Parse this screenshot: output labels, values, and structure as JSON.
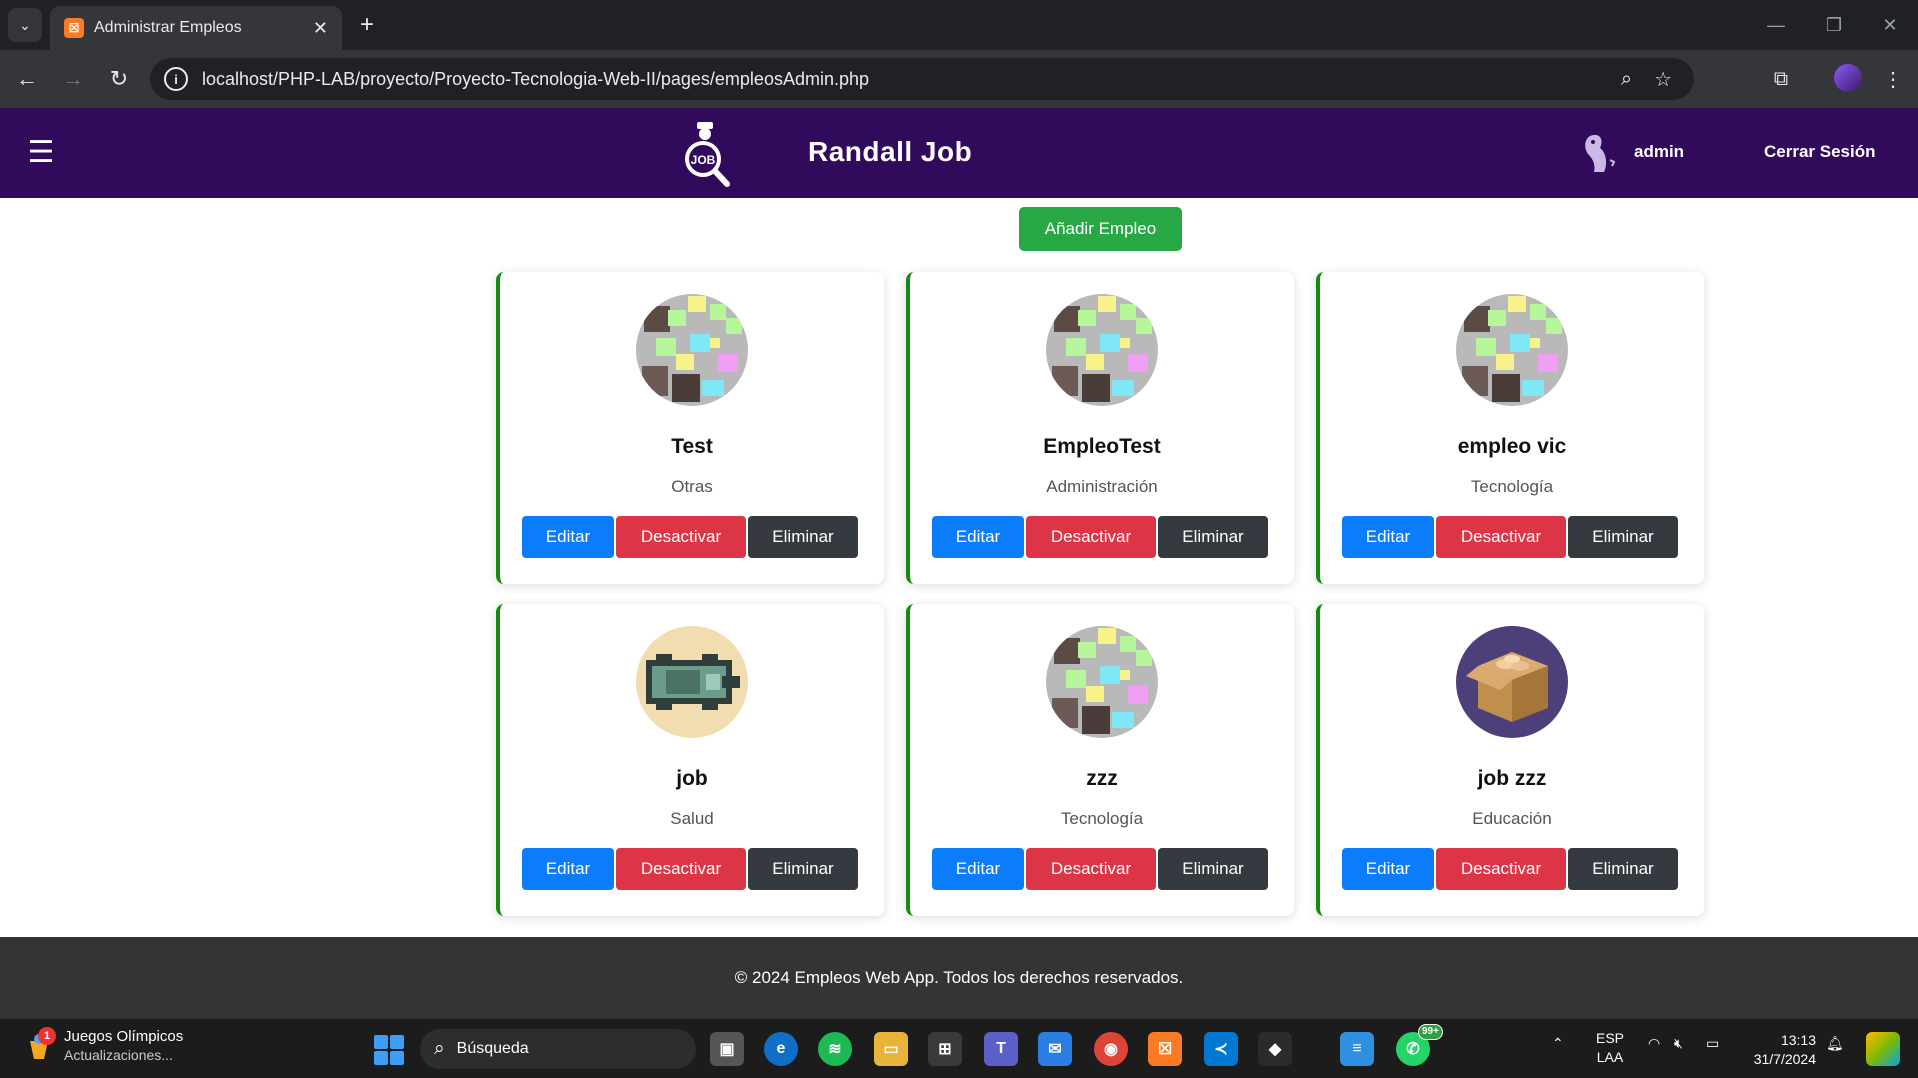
{
  "browser": {
    "tab_title": "Administrar Empleos",
    "url": "localhost/PHP-LAB/proyecto/Proyecto-Tecnologia-Web-II/pages/empleosAdmin.php"
  },
  "navbar": {
    "brand": "Randall Job",
    "logo_text": "JOB",
    "user": "admin",
    "logout": "Cerrar Sesión"
  },
  "main": {
    "add_button": "Añadir Empleo",
    "jobs": [
      {
        "title": "Test",
        "category": "Otras",
        "image": "sticky-notes"
      },
      {
        "title": "EmpleoTest",
        "category": "Administración",
        "image": "sticky-notes"
      },
      {
        "title": "empleo vic",
        "category": "Tecnología",
        "image": "sticky-notes"
      },
      {
        "title": "job",
        "category": "Salud",
        "image": "pixel-car"
      },
      {
        "title": "zzz",
        "category": "Tecnología",
        "image": "sticky-notes"
      },
      {
        "title": "job zzz",
        "category": "Educación",
        "image": "cardboard-box"
      }
    ],
    "actions": {
      "edit": "Editar",
      "deactivate": "Desactivar",
      "delete": "Eliminar"
    }
  },
  "footer": {
    "text": "© 2024 Empleos Web App. Todos los derechos reservados."
  },
  "taskbar": {
    "news_title": "Juegos Olímpicos",
    "news_sub": "Actualizaciones...",
    "news_badge": "1",
    "search_placeholder": "Búsqueda",
    "whatsapp_badge": "99+",
    "lang_top": "ESP",
    "lang_bottom": "LAA",
    "time": "13:13",
    "date": "31/7/2024"
  },
  "colors": {
    "navbar": "#320a5c",
    "add": "#28a745",
    "edit": "#0b7dfb",
    "deactivate": "#dc3545",
    "delete": "#343a40",
    "card_border": "#138a13",
    "footer": "#343434"
  }
}
